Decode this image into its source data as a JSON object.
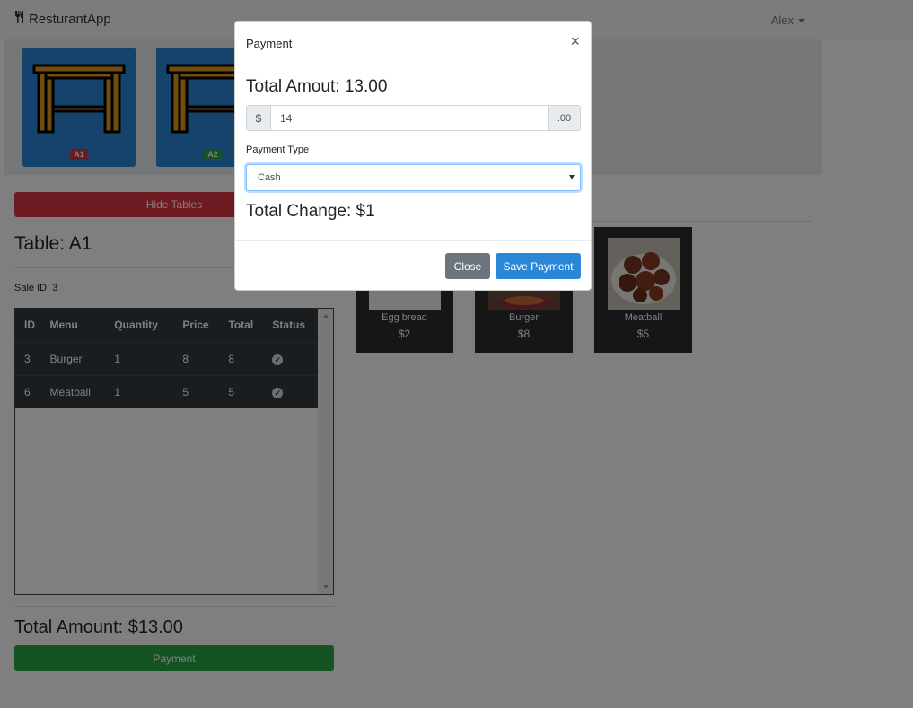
{
  "navbar": {
    "brand": "ResturantApp",
    "user": "Alex"
  },
  "tables": [
    {
      "label": "A1",
      "badge_color": "#dc3545"
    },
    {
      "label": "A2",
      "badge_color": "#28a745"
    }
  ],
  "left": {
    "hide_tables": "Hide Tables",
    "table_heading": "Table: A1",
    "sale_id": "Sale ID: 3",
    "columns": [
      "ID",
      "Menu",
      "Quantity",
      "Price",
      "Total",
      "Status"
    ],
    "rows": [
      [
        "3",
        "Burger",
        "1",
        "8",
        "8"
      ],
      [
        "6",
        "Meatball",
        "1",
        "5",
        "5"
      ]
    ],
    "total_amount": "Total Amount: $13.00",
    "payment_button": "Payment"
  },
  "menu_items": [
    {
      "name": "Egg bread",
      "price": "$2"
    },
    {
      "name": "Burger",
      "price": "$8"
    },
    {
      "name": "Meatball",
      "price": "$5"
    }
  ],
  "modal": {
    "title": "Payment",
    "close_symbol": "×",
    "total": "Total Amout: 13.00",
    "currency": "$",
    "amount": "14",
    "cents": ".00",
    "payment_type_label": "Payment Type",
    "payment_type": "Cash",
    "total_change": "Total Change: $1",
    "close_button": "Close",
    "save_button": "Save Payment"
  }
}
